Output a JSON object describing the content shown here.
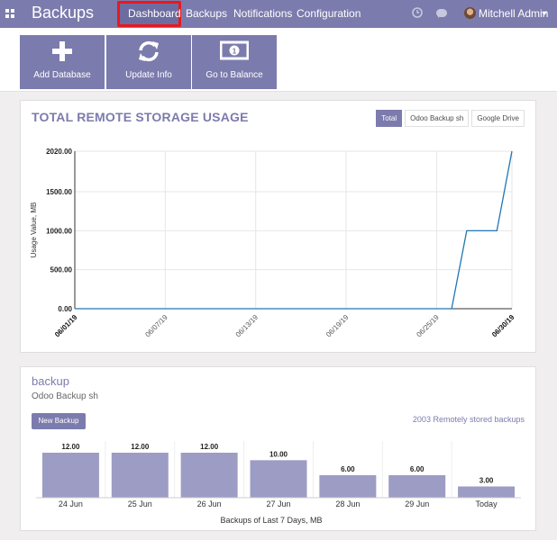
{
  "app": {
    "title": "Backups"
  },
  "nav": {
    "items": [
      {
        "label": "Dashboard",
        "active": true
      },
      {
        "label": "Backups"
      },
      {
        "label": "Notifications"
      },
      {
        "label": "Configuration"
      }
    ],
    "user": "Mitchell Admin",
    "icons": [
      "apps-icon",
      "clock-icon",
      "chat-icon",
      "avatar",
      "caret-down-icon"
    ],
    "accent_color": "#7c7bad",
    "highlight_color": "#e8181e"
  },
  "tiles": [
    {
      "label": "Add Database",
      "icon": "plus-icon"
    },
    {
      "label": "Update Info",
      "icon": "refresh-icon"
    },
    {
      "label": "Go to Balance",
      "icon": "money-icon"
    }
  ],
  "storage_panel": {
    "title": "TOTAL REMOTE STORAGE USAGE",
    "toggles": [
      {
        "label": "Total",
        "active": true
      },
      {
        "label": "Odoo Backup sh"
      },
      {
        "label": "Google Drive"
      }
    ]
  },
  "backup_panel": {
    "title": "backup",
    "subtitle": "Odoo Backup sh",
    "new_button": "New Backup",
    "stored_link": "2003 Remotely stored backups"
  },
  "chart_data": [
    {
      "type": "line",
      "ylabel": "Usage Value, MB",
      "ylim": [
        0,
        2020
      ],
      "yticks": [
        "0.00",
        "500.00",
        "1000.00",
        "1500.00",
        "2020.00"
      ],
      "xticks": [
        "06/01/19",
        "06/07/19",
        "06/13/19",
        "06/19/19",
        "06/25/19",
        "06/30/19"
      ],
      "grid": true,
      "x": [
        "06/01/19",
        "06/26/19",
        "06/27/19",
        "06/29/19",
        "06/30/19"
      ],
      "values": [
        0,
        0,
        1000,
        1000,
        2020
      ],
      "color": "#1f77b4"
    },
    {
      "type": "bar",
      "xlabel": "Backups of Last 7 Days, MB",
      "categories": [
        "24 Jun",
        "25 Jun",
        "26 Jun",
        "27 Jun",
        "28 Jun",
        "29 Jun",
        "Today"
      ],
      "values": [
        12,
        12,
        12,
        10,
        6,
        6,
        3
      ],
      "labels": [
        "12.00",
        "12.00",
        "12.00",
        "10.00",
        "6.00",
        "6.00",
        "3.00"
      ],
      "ylim": [
        0,
        12
      ],
      "color": "#9d9cc4"
    }
  ]
}
